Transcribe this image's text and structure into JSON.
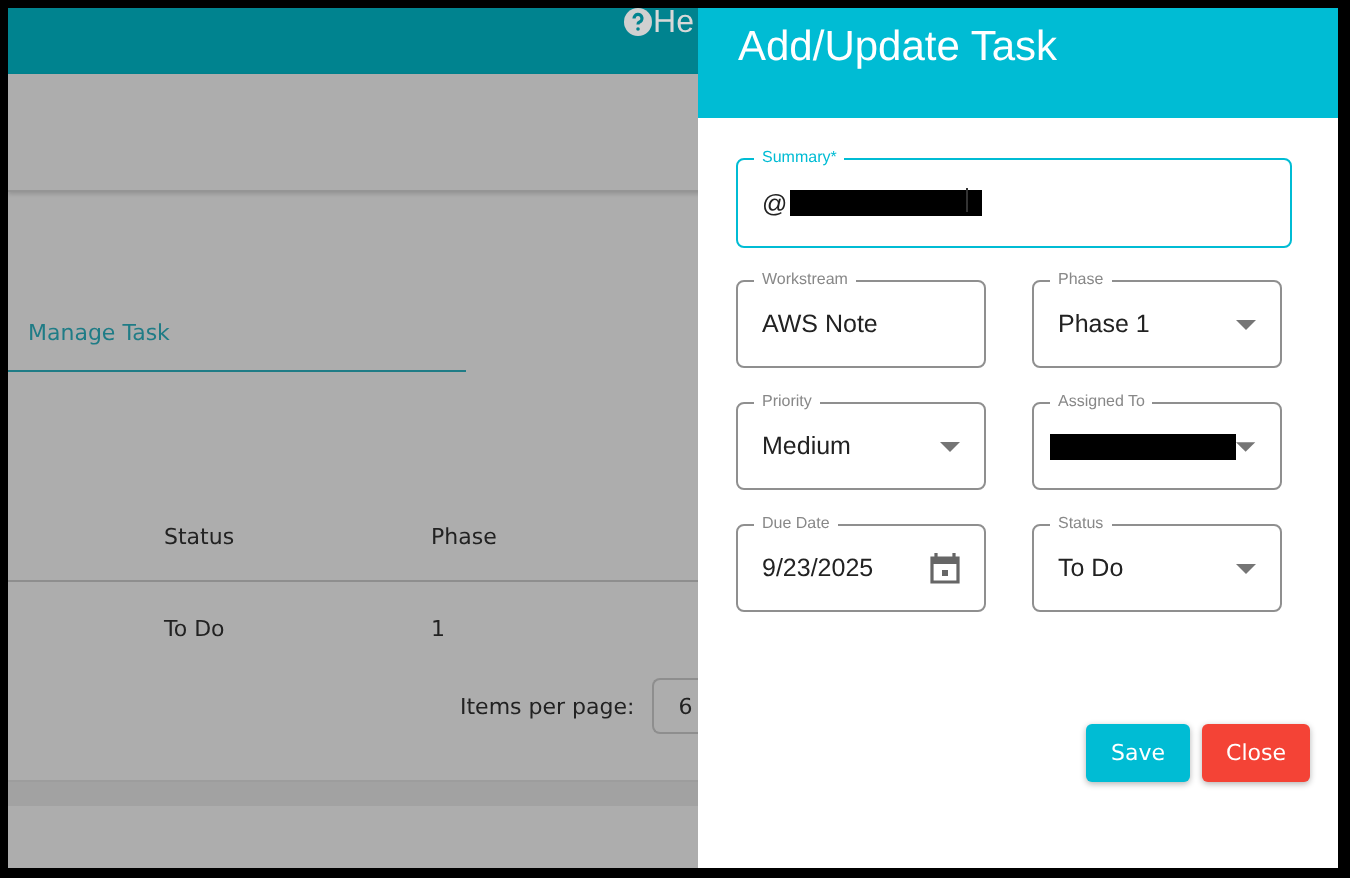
{
  "header": {
    "help_label": "He"
  },
  "tabs": [
    {
      "label": "Manage Task",
      "selected": true
    }
  ],
  "table": {
    "columns": [
      "Status",
      "Phase"
    ],
    "rows": [
      [
        "To Do",
        "1"
      ]
    ]
  },
  "paginator": {
    "label": "Items per page:",
    "page_size": "6"
  },
  "dialog": {
    "title": "Add/Update Task",
    "summary": {
      "label": "Summary*",
      "value": "@",
      "focused": true,
      "redacted": true
    },
    "fields": [
      {
        "label": "Workstream",
        "value": "AWS Note",
        "kind": "text",
        "redacted": false
      },
      {
        "label": "Phase",
        "value": "Phase 1",
        "kind": "select",
        "redacted": false
      },
      {
        "label": "Priority",
        "value": "Medium",
        "kind": "select",
        "redacted": false
      },
      {
        "label": "Assigned To",
        "kind": "select",
        "redacted": true
      },
      {
        "label": "Due Date",
        "value": "9/23/2025",
        "kind": "date",
        "redacted": false
      },
      {
        "label": "Status",
        "value": "To Do",
        "kind": "select",
        "redacted": false
      }
    ],
    "buttons": [
      {
        "label": "Save",
        "kind": "primary"
      },
      {
        "label": "Close",
        "kind": "danger"
      }
    ]
  }
}
